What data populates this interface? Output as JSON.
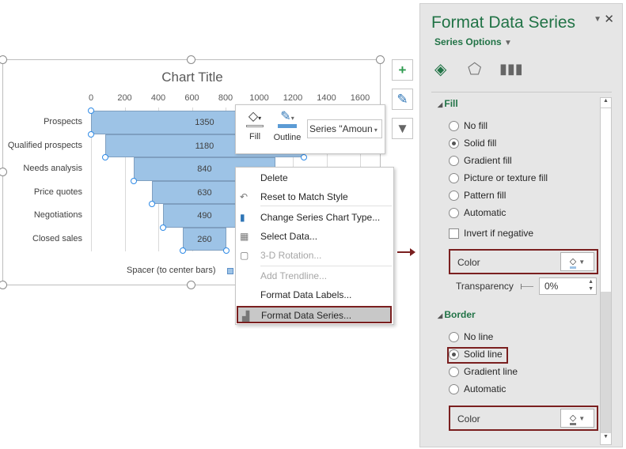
{
  "chart": {
    "title": "Chart Title",
    "legend": "Spacer (to center bars)"
  },
  "chart_data": {
    "type": "bar",
    "orientation": "horizontal",
    "stacked": true,
    "title": "Chart Title",
    "categories": [
      "Prospects",
      "Qualified prospects",
      "Needs analysis",
      "Price quotes",
      "Negotiations",
      "Closed sales"
    ],
    "series": [
      {
        "name": "Spacer (to center bars)",
        "values": [
          0,
          85,
          255,
          360,
          430,
          545
        ],
        "visible": false
      },
      {
        "name": "Amount",
        "values": [
          1350,
          1180,
          840,
          630,
          490,
          260
        ]
      }
    ],
    "xlim": [
      0,
      1600
    ],
    "xticks": [
      "0",
      "200",
      "400",
      "600",
      "800",
      "1000",
      "1200",
      "1400",
      "1600"
    ],
    "grid": true,
    "legend_position": "bottom",
    "bar_color": "#9dc3e6"
  },
  "mini_toolbar": {
    "fill": "Fill",
    "outline": "Outline",
    "series_select": "Series \"Amoun"
  },
  "context_menu": [
    {
      "label": "Delete",
      "enabled": true
    },
    {
      "label": "Reset to Match Style",
      "enabled": true
    },
    {
      "label": "Change Series Chart Type...",
      "enabled": true
    },
    {
      "label": "Select Data...",
      "enabled": true
    },
    {
      "label": "3-D Rotation...",
      "enabled": false
    },
    {
      "label": "Add Trendline...",
      "enabled": false
    },
    {
      "label": "Format Data Labels...",
      "enabled": true
    },
    {
      "label": "Format Data Series...",
      "enabled": true
    }
  ],
  "pane": {
    "title": "Format Data Series",
    "options": "Series Options",
    "fill": {
      "heading": "Fill",
      "options": [
        "No fill",
        "Solid fill",
        "Gradient fill",
        "Picture or texture fill",
        "Pattern fill",
        "Automatic"
      ],
      "selected": "Solid fill",
      "invert": "Invert if negative",
      "color": "Color",
      "transparency_label": "Transparency",
      "transparency": "0%"
    },
    "border": {
      "heading": "Border",
      "options": [
        "No line",
        "Solid line",
        "Gradient line",
        "Automatic"
      ],
      "selected": "Solid line",
      "color": "Color"
    }
  },
  "colors": {
    "accent": "#217346",
    "highlight": "#7a1f1f"
  }
}
